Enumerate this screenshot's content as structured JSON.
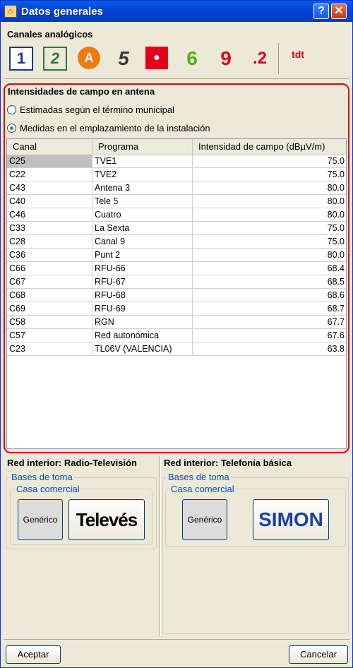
{
  "window": {
    "title": "Datos generales",
    "help_glyph": "?",
    "close_glyph": "✕"
  },
  "analog": {
    "label": "Canales analógicos",
    "channels": [
      {
        "name": "channel-la1-icon",
        "glyph": "1"
      },
      {
        "name": "channel-la2-icon",
        "glyph": "2"
      },
      {
        "name": "channel-antena3-icon",
        "glyph": "A"
      },
      {
        "name": "channel-telecinco-icon",
        "glyph": "5"
      },
      {
        "name": "channel-cuatro-icon",
        "glyph": "●"
      },
      {
        "name": "channel-lasexta-icon",
        "glyph": "6"
      },
      {
        "name": "channel-canal9-icon",
        "glyph": "9"
      },
      {
        "name": "channel-punt2-icon",
        "glyph": ".2"
      },
      {
        "name": "channel-tdt-icon",
        "glyph": "tdt"
      }
    ]
  },
  "antenna": {
    "label": "Intensidades de campo en antena",
    "option_estimated": "Estimadas según el término municipal",
    "option_measured": "Medidas en el emplazamiento de la instalación",
    "selected": "measured",
    "columns": [
      "Canal",
      "Programa",
      "Intensidad de campo (dBµV/m)"
    ],
    "rows": [
      [
        "C25",
        "TVE1",
        "75.0"
      ],
      [
        "C22",
        "TVE2",
        "75.0"
      ],
      [
        "C43",
        "Antena 3",
        "80.0"
      ],
      [
        "C40",
        "Tele 5",
        "80.0"
      ],
      [
        "C46",
        "Cuatro",
        "80.0"
      ],
      [
        "C33",
        "La Sexta",
        "75.0"
      ],
      [
        "C28",
        "Canal 9",
        "75.0"
      ],
      [
        "C36",
        "Punt 2",
        "80.0"
      ],
      [
        "C66",
        "RFU-66",
        "68.4"
      ],
      [
        "C67",
        "RFU-67",
        "68.5"
      ],
      [
        "C68",
        "RFU-68",
        "68.6"
      ],
      [
        "C69",
        "RFU-69",
        "68.7"
      ],
      [
        "C58",
        "RGN",
        "67.7"
      ],
      [
        "C57",
        "Red autonómica",
        "67.6"
      ],
      [
        "C23",
        "TL06V (VALENCIA)",
        "63.8"
      ]
    ]
  },
  "rtv": {
    "title": "Red interior: Radio-Televisión",
    "bases_label": "Bases de toma",
    "brand_label": "Casa comercial",
    "generic_label": "Genérico",
    "brand_logo_text": "Televés"
  },
  "phone": {
    "title": "Red interior: Telefonía básica",
    "bases_label": "Bases de toma",
    "brand_label": "Casa comercial",
    "generic_label": "Genérico",
    "brand_logo_text": "SIMON"
  },
  "footer": {
    "accept_label": "Aceptar",
    "cancel_label": "Cancelar"
  },
  "colors": {
    "highlight_border": "#e0000a",
    "group_label": "#0046d5",
    "title_bar": "#0347d8"
  }
}
